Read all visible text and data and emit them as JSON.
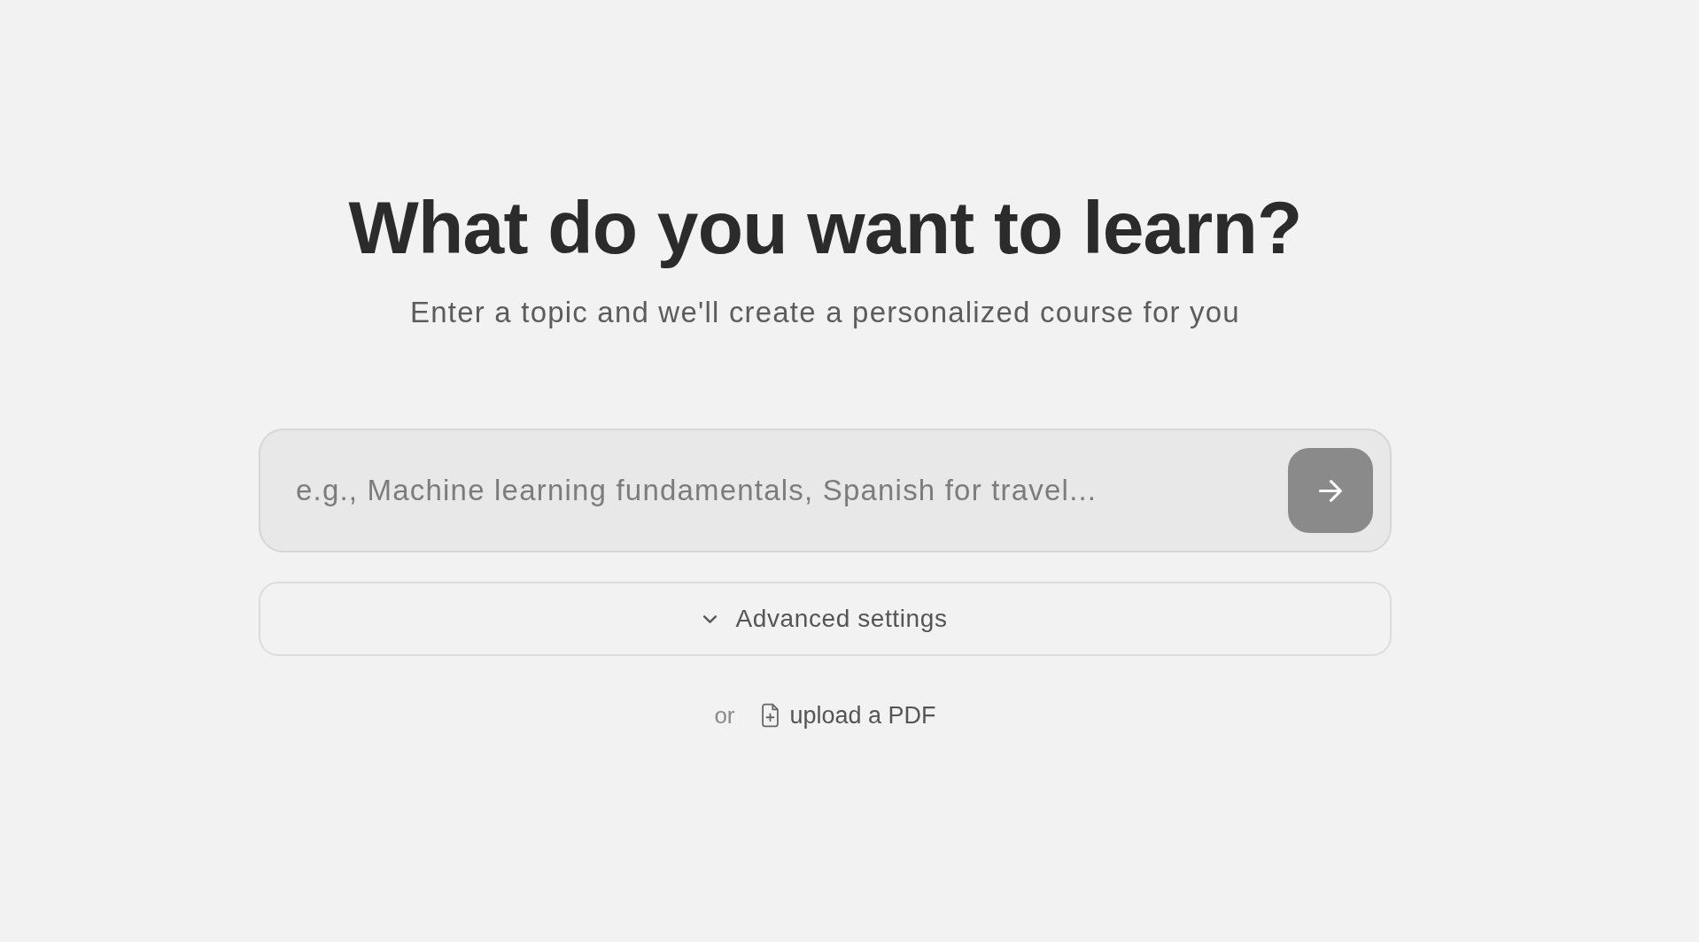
{
  "heading": "What do you want to learn?",
  "subheading": "Enter a topic and we'll create a personalized course for you",
  "topic_input": {
    "placeholder": "e.g., Machine learning fundamentals, Spanish for travel..."
  },
  "submit_button": {
    "disabled": true
  },
  "advanced_settings": {
    "label": "Advanced settings",
    "expanded": false
  },
  "upload": {
    "prefix": "or",
    "link": "upload a PDF"
  }
}
